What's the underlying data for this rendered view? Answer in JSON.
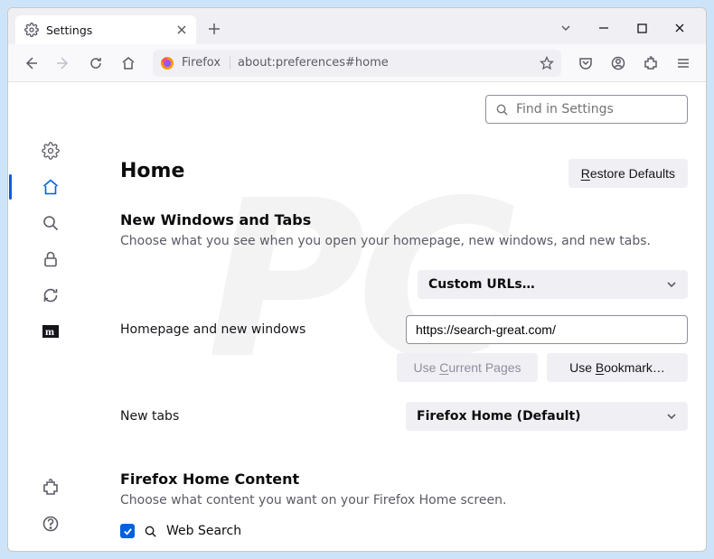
{
  "tab": {
    "title": "Settings"
  },
  "urlbar": {
    "identity": "Firefox",
    "url": "about:preferences#home"
  },
  "search": {
    "placeholder": "Find in Settings"
  },
  "page": {
    "title": "Home"
  },
  "buttons": {
    "restore": "estore Defaults",
    "use_current": "urrent Pages",
    "use_current_prefix": "Use ",
    "use_bookmark_prefix": "Use ",
    "use_bookmark": "ookmark…"
  },
  "section1": {
    "title": "New Windows and Tabs",
    "desc": "Choose what you see when you open your homepage, new windows, and new tabs."
  },
  "homepage": {
    "label": "Homepage and new windows",
    "select_value": "Custom URLs…",
    "url_value": "https://search-great.com/"
  },
  "newtabs": {
    "label": "New tabs",
    "select_value": "Firefox Home (Default)"
  },
  "section2": {
    "title": "Firefox Home Content",
    "desc": "Choose what content you want on your Firefox Home screen."
  },
  "websearch": {
    "label": "Web Search",
    "checked": true
  }
}
